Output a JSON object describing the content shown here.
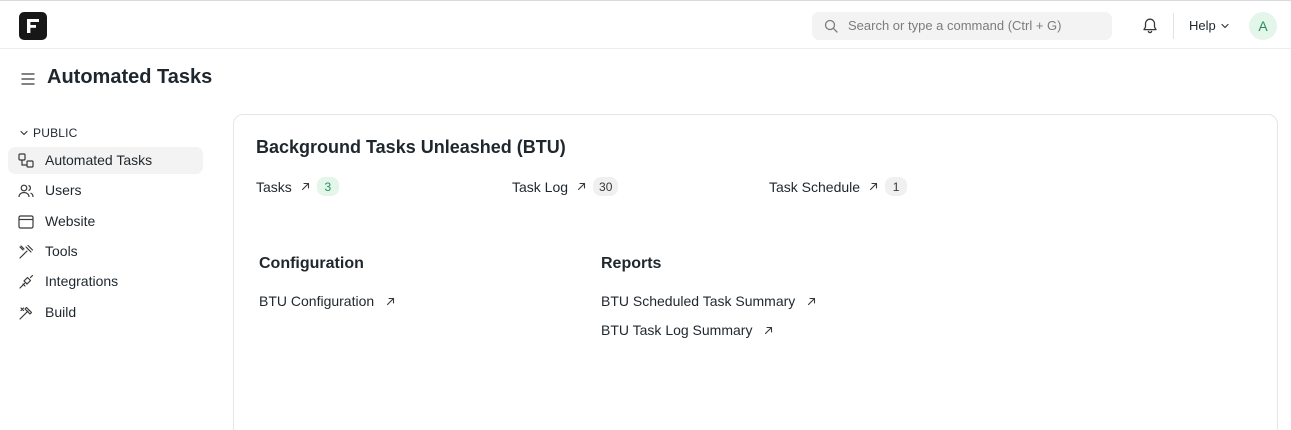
{
  "navbar": {
    "search_placeholder": "Search or type a command (Ctrl + G)",
    "help_label": "Help",
    "avatar_initial": "A"
  },
  "page": {
    "title": "Automated Tasks"
  },
  "sidebar": {
    "section_label": "PUBLIC",
    "items": [
      {
        "label": "Automated Tasks",
        "icon": "workflow-icon",
        "active": true
      },
      {
        "label": "Users",
        "icon": "users-icon"
      },
      {
        "label": "Website",
        "icon": "website-icon"
      },
      {
        "label": "Tools",
        "icon": "tools-icon"
      },
      {
        "label": "Integrations",
        "icon": "integrations-icon"
      },
      {
        "label": "Build",
        "icon": "build-icon"
      }
    ]
  },
  "card": {
    "title": "Background Tasks Unleashed (BTU)",
    "shortcuts": [
      {
        "label": "Tasks",
        "count": "3",
        "badge_color": "#278f5e"
      },
      {
        "label": "Task Log",
        "count": "30"
      },
      {
        "label": "Task Schedule",
        "count": "1"
      }
    ],
    "groups": [
      {
        "title": "Configuration",
        "links": [
          "BTU Configuration"
        ]
      },
      {
        "title": "Reports",
        "links": [
          "BTU Scheduled Task Summary",
          "BTU Task Log Summary"
        ]
      }
    ]
  }
}
